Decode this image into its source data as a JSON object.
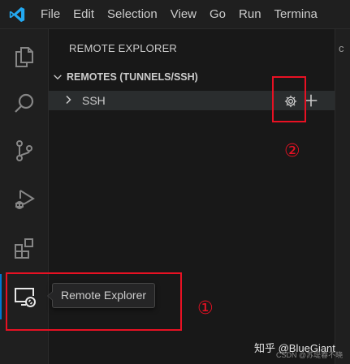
{
  "menu": {
    "items": [
      "File",
      "Edit",
      "Selection",
      "View",
      "Go",
      "Run",
      "Termina"
    ]
  },
  "activity_bar": {
    "items": [
      {
        "icon": "explorer-files-icon"
      },
      {
        "icon": "search-icon"
      },
      {
        "icon": "source-control-icon"
      },
      {
        "icon": "run-debug-icon"
      },
      {
        "icon": "extensions-icon"
      },
      {
        "icon": "remote-explorer-icon",
        "active": true
      }
    ]
  },
  "sidebar": {
    "title": "REMOTE EXPLORER",
    "section_title": "REMOTES (TUNNELS/SSH)",
    "tree": {
      "label": "SSH",
      "actions": [
        "gear-icon",
        "plus-icon"
      ]
    }
  },
  "tooltip": {
    "text": "Remote Explorer"
  },
  "annotations": {
    "marker_1": "①",
    "marker_2": "②",
    "color": "#e81123"
  },
  "watermark": {
    "text": "知乎 @BlueGiant",
    "sub_text": "CSDN @苏堤春不晓"
  },
  "colors": {
    "accent": "#0078d4",
    "vscode_logo": "#23a9f2"
  }
}
